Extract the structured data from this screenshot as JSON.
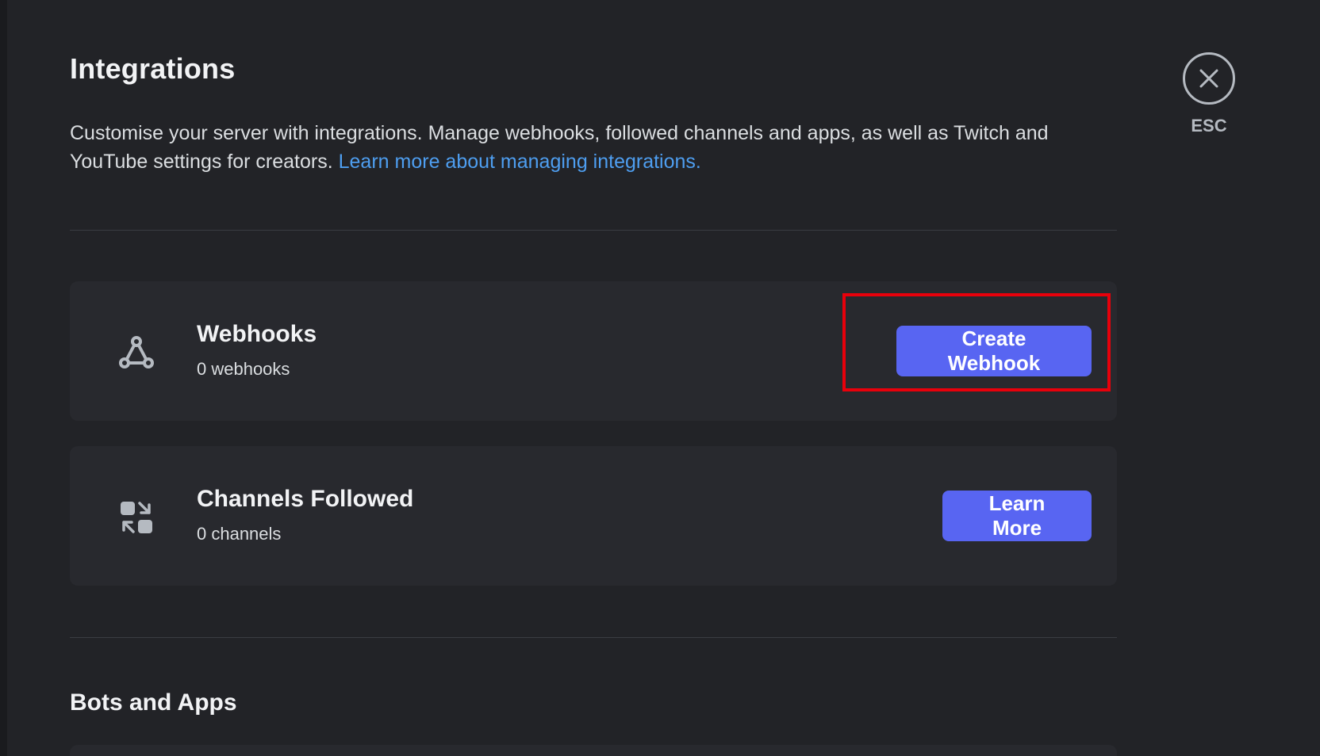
{
  "header": {
    "title": "Integrations",
    "description": "Customise your server with integrations. Manage webhooks, followed channels and apps, as well as Twitch and YouTube settings for creators.",
    "learn_more_link": "Learn more about managing integrations."
  },
  "close": {
    "label": "ESC",
    "icon": "close-icon"
  },
  "webhooks": {
    "icon": "webhook-icon",
    "title": "Webhooks",
    "subtitle": "0 webhooks",
    "button_label": "Create Webhook"
  },
  "channels_followed": {
    "icon": "channels-followed-icon",
    "title": "Channels Followed",
    "subtitle": "0 channels",
    "button_label": "Learn More"
  },
  "bots_and_apps": {
    "title": "Bots and Apps"
  },
  "colors": {
    "background": "#222327",
    "card": "#28292e",
    "accent": "#5865f2",
    "link": "#4e9ef0",
    "highlight": "#e8000b"
  }
}
